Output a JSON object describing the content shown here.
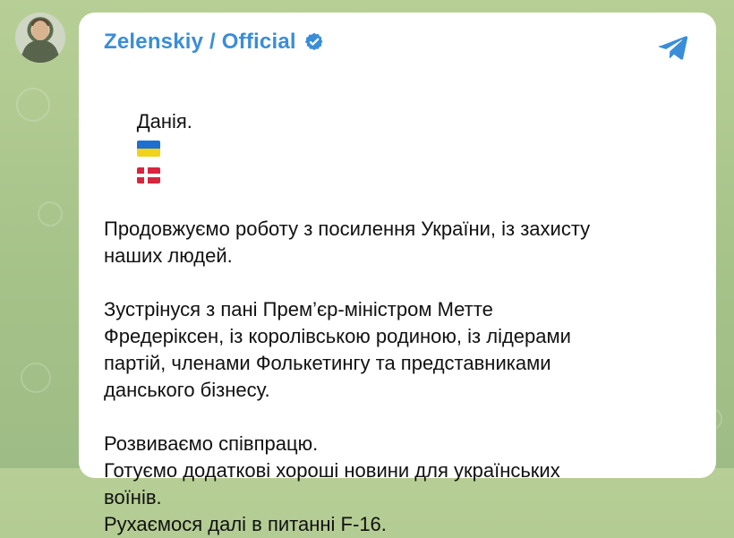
{
  "channel": {
    "name": "Zelenskiy / Official"
  },
  "message": {
    "line1": "Данія.",
    "line2": "Продовжуємо роботу з посилення України, із захисту",
    "line3": "наших людей.",
    "line4": "Зустрінуся з пані Прем’єр-міністром Метте",
    "line5": "Фредеріксен, із королівською родиною, із лідерами",
    "line6": "партій, членами Фолькетингу та представниками",
    "line7": "данського бізнесу.",
    "line8": "Розвиваємо співпрацю.",
    "line9": "Готуємо додаткові хороші новини для українських",
    "line10": "воїнів.",
    "line11": "Рухаємося далі в питанні F-16."
  },
  "icons": {
    "verified": "verified-badge-icon",
    "telegram": "telegram-plane-icon",
    "flag_ua": "ukraine-flag-icon",
    "flag_dk": "denmark-flag-icon"
  },
  "colors": {
    "accent": "#3a8dd8",
    "wallpaper": "#a9c48c",
    "bubble": "#ffffff",
    "text": "#111111"
  }
}
